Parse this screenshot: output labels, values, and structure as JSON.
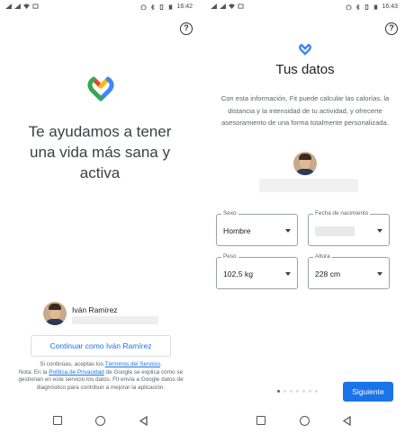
{
  "left_screen": {
    "status_time": "16:42",
    "help_glyph": "?",
    "headline": "Te ayudamos a tener\nuna vida más sana y\nactiva",
    "account_name": "Iván Ramírez",
    "continue_label": "Continuar como Iván Ramírez",
    "legal": {
      "part1": "Si continúas, aceptas los ",
      "terms_link": "Términos del Servicio",
      "part2": ".",
      "part3": "Nota: En la ",
      "privacy_link": "Política de Privacidad",
      "part4": " de Google se explica cómo se gestionan en este servicio los datos. Fit envía a Google datos de diagnóstico para contribuir a mejorar la aplicación."
    }
  },
  "right_screen": {
    "status_time": "16:43",
    "help_glyph": "?",
    "title": "Tus datos",
    "description": "Con esta información, Fit puede calcular las calorías, la distancia y la intensidad de tu actividad, y ofrecerte asesoramiento de una forma totalmente personalizada.",
    "fields": {
      "sex": {
        "label": "Sexo",
        "value": "Hombre"
      },
      "birth": {
        "label": "Fecha de nacimiento",
        "value": ""
      },
      "weight": {
        "label": "Peso",
        "value": "102,5 kg"
      },
      "height": {
        "label": "Altura",
        "value": "228 cm"
      }
    },
    "page_dots_total": 7,
    "page_dot_active": 1,
    "next_label": "Siguiente"
  },
  "icons": {
    "logo": "google-fit-heart-icon",
    "help": "help-circle-icon",
    "nav_recents": "square-icon",
    "nav_home": "circle-icon",
    "nav_back": "triangle-back-icon"
  },
  "colors": {
    "accent": "#1a73e8",
    "fit_blue": "#4285f4",
    "fit_red": "#ea4335",
    "fit_yellow": "#fbbc04",
    "fit_green": "#34a853"
  }
}
